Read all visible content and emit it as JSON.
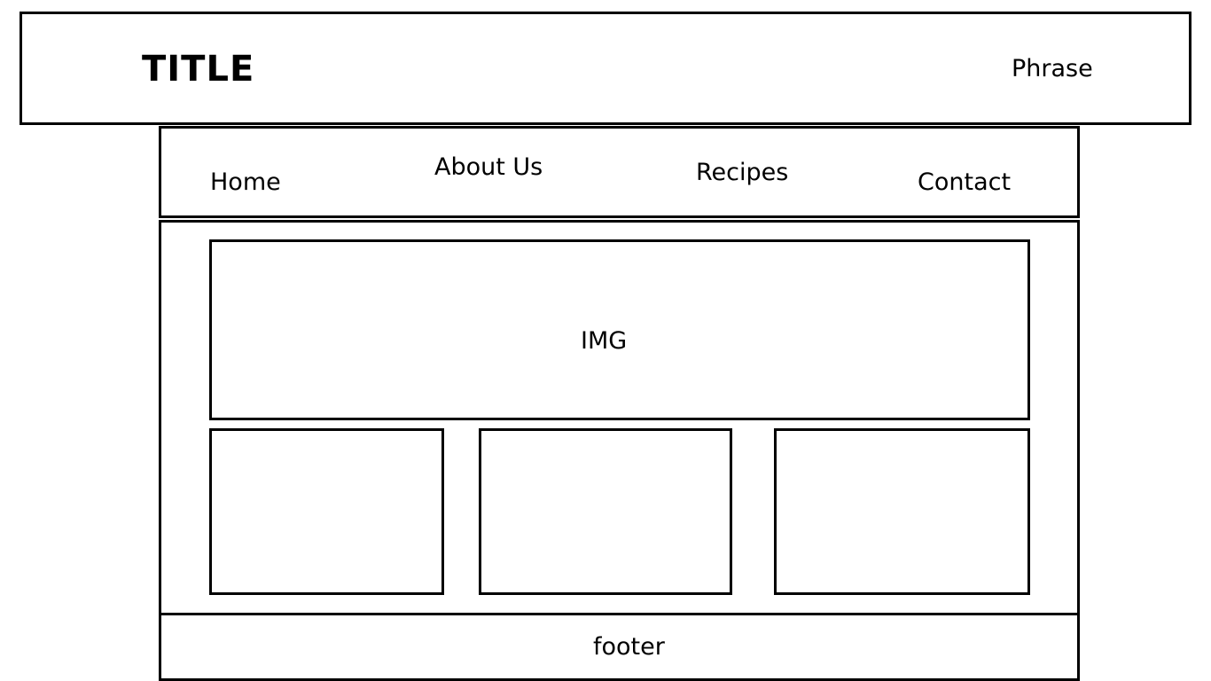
{
  "header": {
    "title": "TITLE",
    "phrase": "Phrase"
  },
  "nav": {
    "items": [
      {
        "label": "Home"
      },
      {
        "label": "About Us"
      },
      {
        "label": "Recipes"
      },
      {
        "label": "Contact"
      }
    ]
  },
  "main": {
    "image_label": "IMG"
  },
  "footer": {
    "label": "footer"
  },
  "colors": {
    "stroke": "#000000",
    "background": "#ffffff"
  }
}
